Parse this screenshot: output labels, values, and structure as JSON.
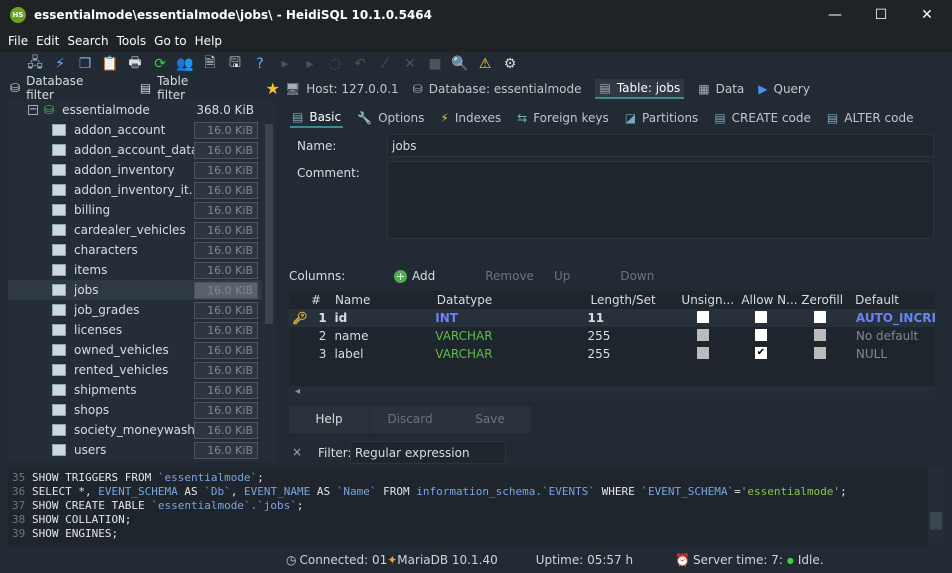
{
  "window": {
    "title": "essentialmode\\essentialmode\\jobs\\ - HeidiSQL 10.1.0.5464",
    "logo": "HS",
    "minimize": "—",
    "maximize": "☐",
    "close": "✕"
  },
  "menu": [
    "File",
    "Edit",
    "Search",
    "Tools",
    "Go to",
    "Help"
  ],
  "filters": {
    "database": "Database filter",
    "table": "Table filter"
  },
  "tree": {
    "root": {
      "name": "essentialmode",
      "size": "368.0 KiB"
    },
    "tables": [
      {
        "name": "addon_account",
        "size": "16.0 KiB"
      },
      {
        "name": "addon_account_data",
        "size": "16.0 KiB"
      },
      {
        "name": "addon_inventory",
        "size": "16.0 KiB"
      },
      {
        "name": "addon_inventory_it…",
        "size": "16.0 KiB"
      },
      {
        "name": "billing",
        "size": "16.0 KiB"
      },
      {
        "name": "cardealer_vehicles",
        "size": "16.0 KiB"
      },
      {
        "name": "characters",
        "size": "16.0 KiB"
      },
      {
        "name": "items",
        "size": "16.0 KiB"
      },
      {
        "name": "jobs",
        "size": "16.0 KiB"
      },
      {
        "name": "job_grades",
        "size": "16.0 KiB"
      },
      {
        "name": "licenses",
        "size": "16.0 KiB"
      },
      {
        "name": "owned_vehicles",
        "size": "16.0 KiB"
      },
      {
        "name": "rented_vehicles",
        "size": "16.0 KiB"
      },
      {
        "name": "shipments",
        "size": "16.0 KiB"
      },
      {
        "name": "shops",
        "size": "16.0 KiB"
      },
      {
        "name": "society_moneywash",
        "size": "16.0 KiB"
      },
      {
        "name": "users",
        "size": "16.0 KiB"
      }
    ]
  },
  "main_tabs": [
    "Host: 127.0.0.1",
    "Database: essentialmode",
    "Table: jobs",
    "Data",
    "Query"
  ],
  "sub_tabs": [
    "Basic",
    "Options",
    "Indexes",
    "Foreign keys",
    "Partitions",
    "CREATE code",
    "ALTER code"
  ],
  "form": {
    "name_label": "Name:",
    "name_value": "jobs",
    "comment_label": "Comment:",
    "comment_value": ""
  },
  "columns_bar": {
    "label": "Columns:",
    "add": "Add",
    "remove": "Remove",
    "up": "Up",
    "down": "Down"
  },
  "grid": {
    "headers": [
      "#",
      "Name",
      "Datatype",
      "Length/Set",
      "Unsign...",
      "Allow N...",
      "Zerofill",
      "Default"
    ],
    "rows": [
      {
        "num": "1",
        "name": "id",
        "type": "INT",
        "length": "11",
        "unsigned": false,
        "allow_null": false,
        "zerofill": false,
        "default": "AUTO_INCREM",
        "primary": true
      },
      {
        "num": "2",
        "name": "name",
        "type": "VARCHAR",
        "length": "255",
        "unsigned": null,
        "allow_null": false,
        "zerofill": null,
        "default": "No default",
        "primary": false
      },
      {
        "num": "3",
        "name": "label",
        "type": "VARCHAR",
        "length": "255",
        "unsigned": null,
        "allow_null": true,
        "zerofill": null,
        "default": "NULL",
        "primary": false
      }
    ]
  },
  "buttons": {
    "help": "Help",
    "discard": "Discard",
    "save": "Save"
  },
  "filter": {
    "label": "Filter:",
    "value": "Regular expression"
  },
  "log": [
    {
      "n": "35",
      "parts": [
        [
          "kw",
          "SHOW TRIGGERS FROM "
        ],
        [
          "id",
          "`essentialmode`"
        ],
        [
          "kw",
          ";"
        ]
      ]
    },
    {
      "n": "36",
      "parts": [
        [
          "kw",
          "SELECT *, "
        ],
        [
          "id",
          "EVENT_SCHEMA"
        ],
        [
          "kw",
          " AS "
        ],
        [
          "id",
          "`Db`"
        ],
        [
          "kw",
          ", "
        ],
        [
          "id",
          "EVENT_NAME"
        ],
        [
          "kw",
          " AS "
        ],
        [
          "id",
          "`Name`"
        ],
        [
          "kw",
          " FROM "
        ],
        [
          "id",
          "information_schema.`EVENTS`"
        ],
        [
          "kw",
          " WHERE "
        ],
        [
          "id",
          "`EVENT_SCHEMA`"
        ],
        [
          "kw",
          "="
        ],
        [
          "st",
          "'essentialmode'"
        ],
        [
          "kw",
          ";"
        ]
      ]
    },
    {
      "n": "37",
      "parts": [
        [
          "kw",
          "SHOW CREATE TABLE "
        ],
        [
          "id",
          "`essentialmode`.`jobs`"
        ],
        [
          "kw",
          ";"
        ]
      ]
    },
    {
      "n": "38",
      "parts": [
        [
          "kw",
          "SHOW COLLATION;"
        ]
      ]
    },
    {
      "n": "39",
      "parts": [
        [
          "kw",
          "SHOW ENGINES;"
        ]
      ]
    }
  ],
  "status": {
    "connected": "Connected: 01",
    "server": "MariaDB 10.1.40",
    "uptime": "Uptime: 05:57 h",
    "server_time": "Server time: 7:",
    "state": "Idle."
  }
}
